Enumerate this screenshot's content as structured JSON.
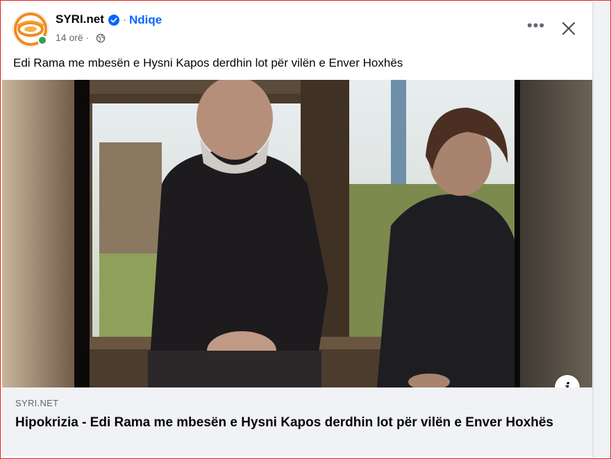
{
  "post": {
    "page_name": "SYRI.net",
    "follow_label": "Ndiqe",
    "separator": "·",
    "time": "14 orë ·",
    "caption": "Edi Rama me mbesën e Hysni Kapos derdhin lot për vilën e Enver Hoxhës",
    "more_label": "•••"
  },
  "link_preview": {
    "domain": "SYRI.NET",
    "title": "Hipokrizia - Edi Rama me mbesën e Hysni Kapos derdhin lot për vilën e Enver Hoxhës",
    "info_label": "i"
  },
  "icons": {
    "avatar": "syri-logo-icon",
    "verified": "verified-badge-icon",
    "audience": "globe-icon",
    "more": "more-options-icon",
    "close": "close-icon",
    "info": "info-icon"
  },
  "colors": {
    "accent": "#0866ff",
    "online": "#31a24c",
    "logo_orange": "#f08a1d",
    "preview_bg": "#f0f2f5",
    "frame_border": "#e41d1d"
  }
}
